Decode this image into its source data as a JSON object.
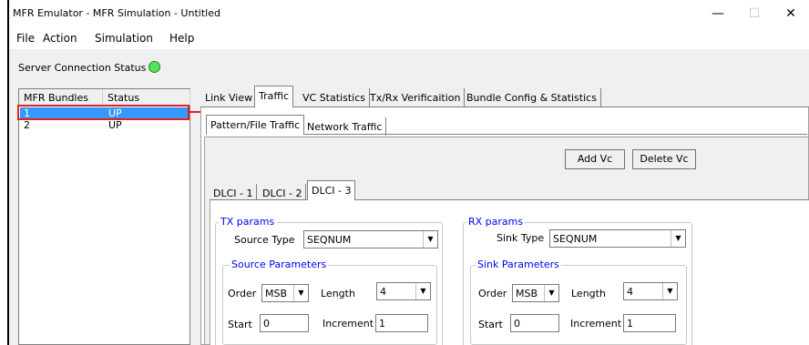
{
  "window": {
    "title": "MFR Emulator - MFR Simulation - Untitled",
    "minimize": "—",
    "maximize": "☐",
    "close": "✕"
  },
  "menu": {
    "file": "File",
    "action": "Action",
    "simulation": "Simulation",
    "help": "Help"
  },
  "server": {
    "label": "Server Connection Status",
    "status_color": "#55e655"
  },
  "bundles": {
    "col_name": "MFR Bundles",
    "col_status": "Status",
    "rows": [
      {
        "name": "1",
        "status": "UP"
      },
      {
        "name": "2",
        "status": "UP"
      }
    ]
  },
  "main_tabs": [
    {
      "label": "Link View"
    },
    {
      "label": "Traffic"
    },
    {
      "label": "VC Statistics"
    },
    {
      "label": "Tx/Rx Verificaition"
    },
    {
      "label": "Bundle Config & Statistics"
    }
  ],
  "sub_tabs": [
    {
      "label": "Pattern/File Traffic"
    },
    {
      "label": "Network Traffic"
    }
  ],
  "buttons": {
    "add_vc": "Add Vc",
    "delete_vc": "Delete Vc"
  },
  "dlci_tabs": [
    {
      "label": "DLCI - 1"
    },
    {
      "label": "DLCI - 2"
    },
    {
      "label": "DLCI - 3"
    }
  ],
  "tx": {
    "group": "TX params",
    "source_type_label": "Source Type",
    "source_type_value": "SEQNUM",
    "source_params_label": "Source Parameters",
    "order_label": "Order",
    "order_value": "MSB",
    "length_label": "Length",
    "length_value": "4",
    "start_label": "Start",
    "start_value": "0",
    "increment_label": "Increment",
    "increment_value": "1"
  },
  "rx": {
    "group": "RX params",
    "sink_type_label": "Sink Type",
    "sink_type_value": "SEQNUM",
    "sink_params_label": "Sink Parameters",
    "order_label": "Order",
    "order_value": "MSB",
    "length_label": "Length",
    "length_value": "4",
    "start_label": "Start",
    "start_value": "0",
    "increment_label": "Increment",
    "increment_value": "1"
  },
  "colors": {
    "highlight": "#e02020",
    "selection": "#3399ff",
    "group_label": "#0000ff"
  },
  "icons": {
    "combo_arrow": "▼"
  }
}
